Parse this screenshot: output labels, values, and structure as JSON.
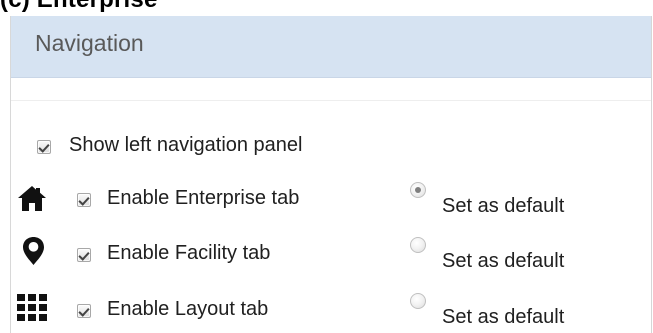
{
  "caption": "(c) Enterprise",
  "panel": {
    "title": "Navigation"
  },
  "options": {
    "show_left_navigation_panel": {
      "label": "Show left navigation panel",
      "checked": true
    },
    "tabs": [
      {
        "label": "Enable Enterprise tab",
        "checked": true,
        "default_label": "Set as default",
        "default_selected": true,
        "icon": "home-icon"
      },
      {
        "label": "Enable Facility tab",
        "checked": true,
        "default_label": "Set as default",
        "default_selected": false,
        "icon": "location-pin-icon"
      },
      {
        "label": "Enable Layout tab",
        "checked": true,
        "default_label": "Set as default",
        "default_selected": false,
        "icon": "grid-icon"
      }
    ]
  },
  "colors": {
    "header_background": "#d6e3f2",
    "title_text": "#595959",
    "body_text": "#202020",
    "icon": "#111111"
  }
}
